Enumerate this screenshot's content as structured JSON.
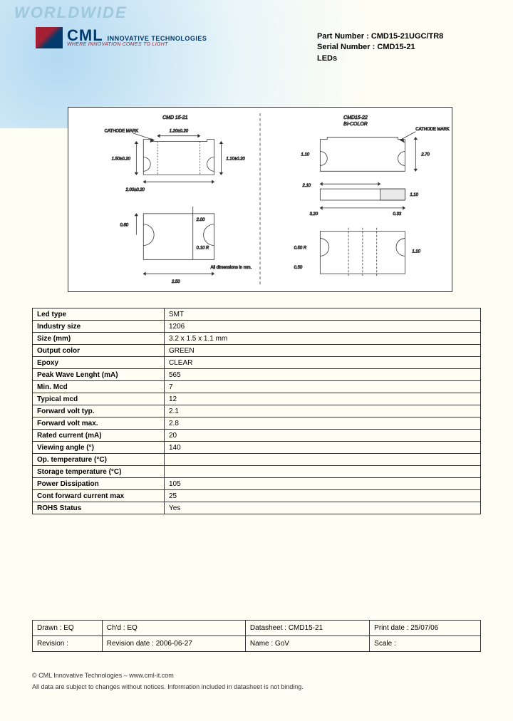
{
  "watermark": "WORLDWIDE",
  "logo": {
    "name": "CML",
    "tag1": "INNOVATIVE TECHNOLOGIES",
    "tag2": "WHERE INNOVATION COMES TO LIGHT"
  },
  "header": {
    "part_label": "Part Number :",
    "part_value": "CMD15-21UGC/TR8",
    "serial_label": "Serial Number :",
    "serial_value": "CMD15-21",
    "category": "LEDs"
  },
  "diagram": {
    "left_title": "CMD 15-21",
    "right_title": "CMD15-22",
    "right_sub": "BI-COLOR",
    "cathode_mark": "CATHODE MARK",
    "all_dim": "All dimensions in mm.",
    "dims": {
      "d1": "1.20±0.20",
      "d2": "1.50±0.20",
      "d3": "2.00±0.20",
      "d4": "1.10±0.20",
      "d5": "0.60",
      "d6": "2.00",
      "d7": "0.10 R",
      "d8": "2.50",
      "d9": "2.10",
      "d10": "0.33",
      "d11": "1.10",
      "d12": "2.70",
      "d13": "3.20",
      "d14": "1.10",
      "d15": "0.50",
      "d16": "0.50 R"
    }
  },
  "specs": [
    {
      "label": "Led type",
      "value": "SMT"
    },
    {
      "label": "Industry size",
      "value": "1206"
    },
    {
      "label": "Size (mm)",
      "value": "3.2 x 1.5 x 1.1 mm"
    },
    {
      "label": "Output color",
      "value": "GREEN"
    },
    {
      "label": "Epoxy",
      "value": "CLEAR"
    },
    {
      "label": "Peak Wave Lenght (mA)",
      "value": "565"
    },
    {
      "label": "Min. Mcd",
      "value": "7"
    },
    {
      "label": "Typical mcd",
      "value": "12"
    },
    {
      "label": "Forward volt typ.",
      "value": "2.1"
    },
    {
      "label": "Forward volt max.",
      "value": "2.8"
    },
    {
      "label": "Rated current (mA)",
      "value": "20"
    },
    {
      "label": "Viewing angle (°)",
      "value": "140"
    },
    {
      "label": "Op. temperature (°C)",
      "value": ""
    },
    {
      "label": "Storage temperature (°C)",
      "value": ""
    },
    {
      "label": "Power Dissipation",
      "value": "105"
    },
    {
      "label": "Cont forward current max",
      "value": "25"
    },
    {
      "label": "ROHS Status",
      "value": "Yes"
    }
  ],
  "titleblock": {
    "r1": [
      "Drawn : EQ",
      "Ch'd : EQ",
      "Datasheet : CMD15-21",
      "Print date : 25/07/06"
    ],
    "r2": [
      "Revision :",
      "Revision date : 2006-06-27",
      "Name : GoV",
      "Scale :"
    ]
  },
  "footer": {
    "line1": "© CML Innovative Technologies – www.cml-it.com",
    "line2": "All data are subject to changes without notices. Information included in datasheet is not binding."
  }
}
